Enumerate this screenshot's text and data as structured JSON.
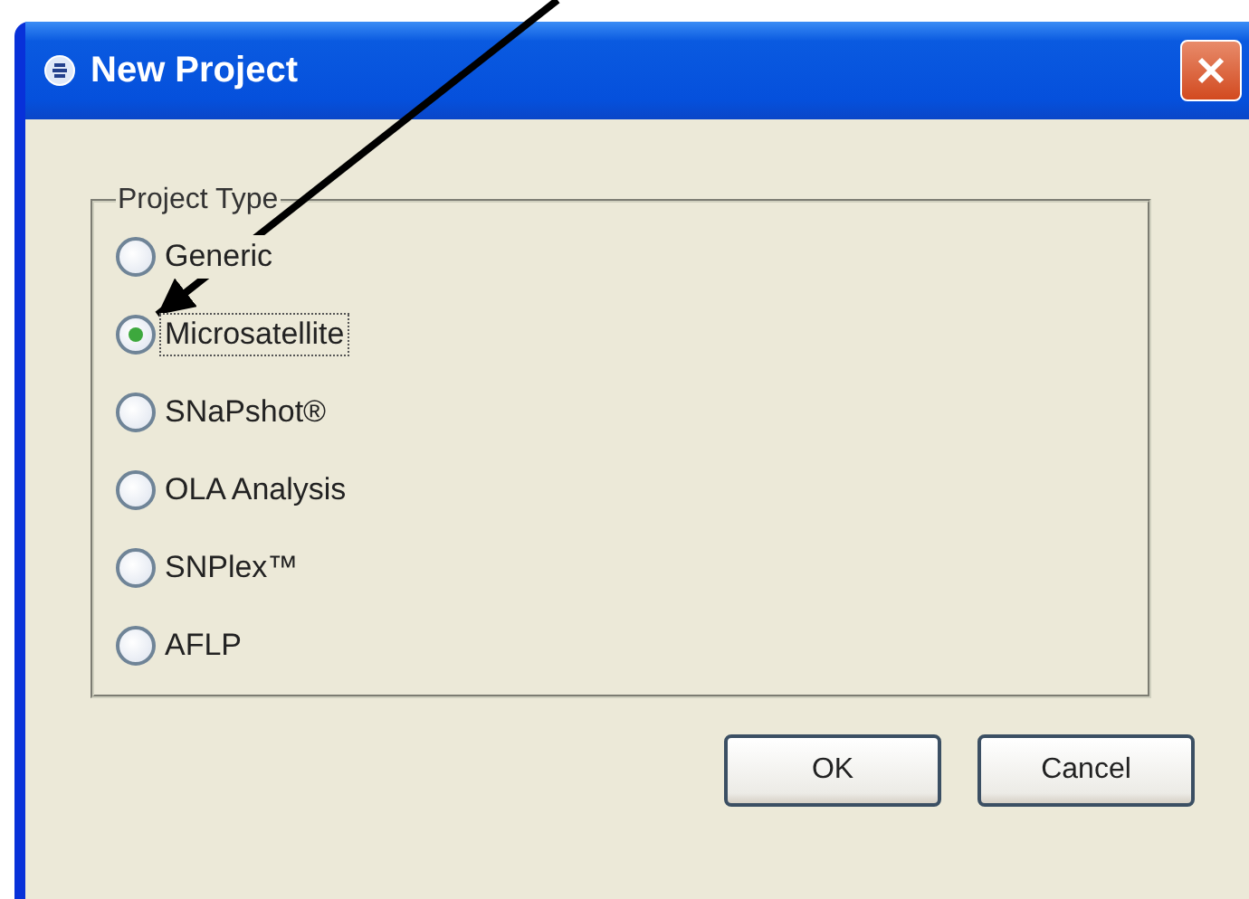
{
  "window": {
    "title": "New Project"
  },
  "group": {
    "label": "Project Type",
    "options": [
      {
        "label": "Generic",
        "selected": false
      },
      {
        "label": "Microsatellite",
        "selected": true
      },
      {
        "label": "SNaPshot®",
        "selected": false
      },
      {
        "label": "OLA Analysis",
        "selected": false
      },
      {
        "label": "SNPlex™",
        "selected": false
      },
      {
        "label": "AFLP",
        "selected": false
      }
    ]
  },
  "buttons": [
    "OK",
    "Cancel"
  ]
}
